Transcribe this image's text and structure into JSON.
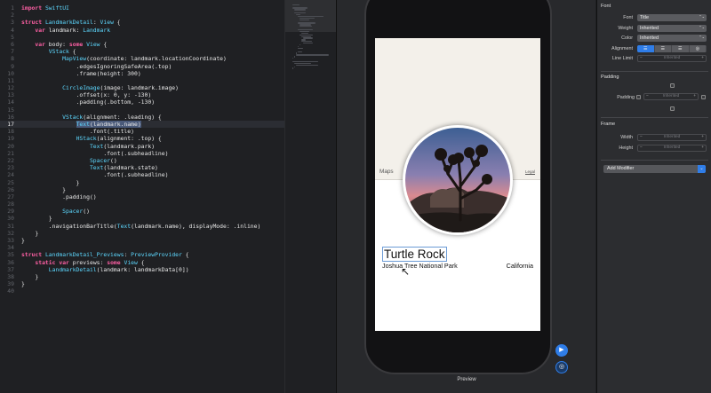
{
  "editor": {
    "lines": [
      {
        "n": "1",
        "t": "import SwiftUI"
      },
      {
        "n": "2",
        "t": ""
      },
      {
        "n": "3",
        "t": "struct LandmarkDetail: View {"
      },
      {
        "n": "4",
        "t": "    var landmark: Landmark"
      },
      {
        "n": "5",
        "t": ""
      },
      {
        "n": "6",
        "t": "    var body: some View {"
      },
      {
        "n": "7",
        "t": "        VStack {"
      },
      {
        "n": "8",
        "t": "            MapView(coordinate: landmark.locationCoordinate)"
      },
      {
        "n": "9",
        "t": "                .edgesIgnoringSafeArea(.top)"
      },
      {
        "n": "10",
        "t": "                .frame(height: 300)"
      },
      {
        "n": "11",
        "t": ""
      },
      {
        "n": "12",
        "t": "            CircleImage(image: landmark.image)"
      },
      {
        "n": "13",
        "t": "                .offset(x: 0, y: -130)"
      },
      {
        "n": "14",
        "t": "                .padding(.bottom, -130)"
      },
      {
        "n": "15",
        "t": ""
      },
      {
        "n": "16",
        "t": "            VStack(alignment: .leading) {"
      },
      {
        "n": "17",
        "t": "                Text(landmark.name)"
      },
      {
        "n": "18",
        "t": "                    .font(.title)"
      },
      {
        "n": "19",
        "t": "                HStack(alignment: .top) {"
      },
      {
        "n": "20",
        "t": "                    Text(landmark.park)"
      },
      {
        "n": "21",
        "t": "                        .font(.subheadline)"
      },
      {
        "n": "22",
        "t": "                    Spacer()"
      },
      {
        "n": "23",
        "t": "                    Text(landmark.state)"
      },
      {
        "n": "24",
        "t": "                        .font(.subheadline)"
      },
      {
        "n": "25",
        "t": "                }"
      },
      {
        "n": "26",
        "t": "            }"
      },
      {
        "n": "27",
        "t": "            .padding()"
      },
      {
        "n": "28",
        "t": ""
      },
      {
        "n": "29",
        "t": "            Spacer()"
      },
      {
        "n": "30",
        "t": "        }"
      },
      {
        "n": "31",
        "t": "        .navigationBarTitle(Text(landmark.name), displayMode: .inline)"
      },
      {
        "n": "32",
        "t": "    }"
      },
      {
        "n": "33",
        "t": "}"
      },
      {
        "n": "34",
        "t": ""
      },
      {
        "n": "35",
        "t": "struct LandmarkDetail_Previews: PreviewProvider {"
      },
      {
        "n": "36",
        "t": "    static var previews: some View {"
      },
      {
        "n": "37",
        "t": "        LandmarkDetail(landmark: landmarkData[0])"
      },
      {
        "n": "38",
        "t": "    }"
      },
      {
        "n": "39",
        "t": "}"
      },
      {
        "n": "40",
        "t": ""
      }
    ],
    "current_line": 17,
    "selection": "Text(landmark.name)"
  },
  "preview": {
    "maps_label": "Maps",
    "legal_label": "Legal",
    "title": "Turtle Rock",
    "park": "Joshua Tree National Park",
    "state": "California",
    "caption": "Preview"
  },
  "inspector": {
    "font_section": "Font",
    "font_label": "Font",
    "font_value": "Title",
    "weight_label": "Weight",
    "weight_value": "Inherited",
    "color_label": "Color",
    "color_value": "Inherited",
    "alignment_label": "Alignment",
    "line_limit_label": "Line Limit",
    "line_limit_value": "Inherited",
    "padding_section": "Padding",
    "padding_label": "Padding",
    "padding_value": "Inherited",
    "frame_section": "Frame",
    "width_label": "Width",
    "width_value": "Inherited",
    "height_label": "Height",
    "height_value": "Inherited",
    "add_modifier_label": "Add Modifier"
  },
  "icons": {
    "apple_logo": "apple-logo-icon",
    "cursor": "pointer-cursor-icon",
    "live_preview": "play-icon",
    "inspect_preview": "inspect-icon",
    "align_leading": "align-leading-icon",
    "align_center": "align-center-icon",
    "align_trailing": "align-trailing-icon",
    "align_justify": "align-justify-icon"
  },
  "colors": {
    "editor_bg": "#1f2023",
    "keyword": "#fc5fa3",
    "type": "#5dd8ff",
    "accent": "#2f7de8"
  }
}
